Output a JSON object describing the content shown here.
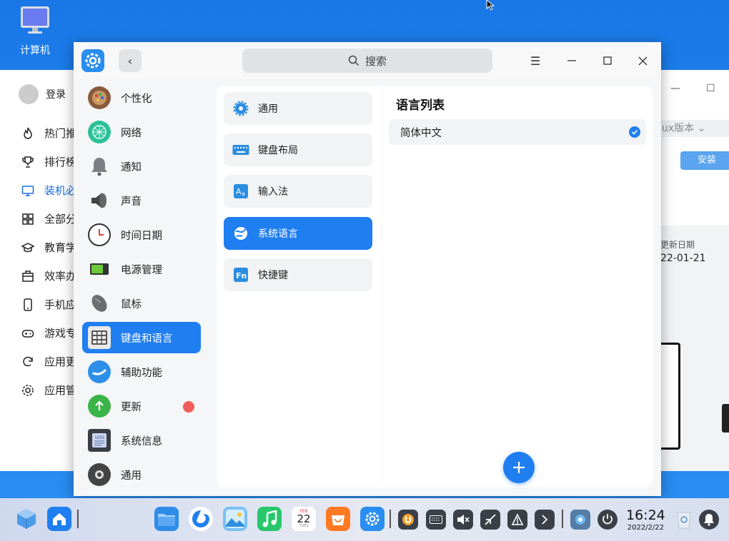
{
  "desktop": {
    "icon_label": "计算机"
  },
  "bg_app": {
    "login": "登录",
    "items": [
      {
        "label": "热门推",
        "icon": "fire-icon"
      },
      {
        "label": "排行榜",
        "icon": "trophy-icon"
      },
      {
        "label": "装机必",
        "icon": "monitor-icon"
      },
      {
        "label": "全部分",
        "icon": "grid-icon"
      },
      {
        "label": "教育学",
        "icon": "graduation-cap-icon"
      },
      {
        "label": "效率办",
        "icon": "briefcase-icon"
      },
      {
        "label": "手机应",
        "icon": "phone-icon"
      },
      {
        "label": "游戏专",
        "icon": "gamepad-icon"
      },
      {
        "label": "应用更",
        "icon": "refresh-icon"
      },
      {
        "label": "应用管",
        "icon": "gear-icon"
      }
    ],
    "version_label": "ux版本",
    "install_label": "安装",
    "update_date_label": "更新日期",
    "update_date_value": "22-01-21"
  },
  "settings": {
    "search_placeholder": "搜索",
    "nav": [
      {
        "label": "个性化",
        "icon": "palette-icon"
      },
      {
        "label": "网络",
        "icon": "network-icon"
      },
      {
        "label": "通知",
        "icon": "bell-icon"
      },
      {
        "label": "声音",
        "icon": "speaker-icon"
      },
      {
        "label": "时间日期",
        "icon": "clock-icon"
      },
      {
        "label": "电源管理",
        "icon": "battery-icon"
      },
      {
        "label": "鼠标",
        "icon": "mouse-icon"
      },
      {
        "label": "键盘和语言",
        "icon": "keyboard-icon"
      },
      {
        "label": "辅助功能",
        "icon": "accessibility-icon"
      },
      {
        "label": "更新",
        "icon": "update-arrow-icon"
      },
      {
        "label": "系统信息",
        "icon": "system-info-icon"
      },
      {
        "label": "通用",
        "icon": "general-gear-icon"
      }
    ],
    "sub": [
      {
        "label": "通用",
        "icon": "gear-icon"
      },
      {
        "label": "键盘布局",
        "icon": "keyboard-layout-icon"
      },
      {
        "label": "输入法",
        "icon": "input-method-icon"
      },
      {
        "label": "系统语言",
        "icon": "globe-icon"
      },
      {
        "label": "快捷键",
        "icon": "shortcut-fn-icon"
      }
    ],
    "section_title": "语言列表",
    "languages": [
      {
        "label": "简体中文",
        "selected": true
      }
    ]
  },
  "dock": {
    "calendar": {
      "month": "FEB",
      "day": "22",
      "weekday": "TUES"
    },
    "time": "16:24",
    "date": "2022/2/22"
  },
  "colors": {
    "accent": "#1f7ef0",
    "update_dot": "#f25c5c"
  }
}
